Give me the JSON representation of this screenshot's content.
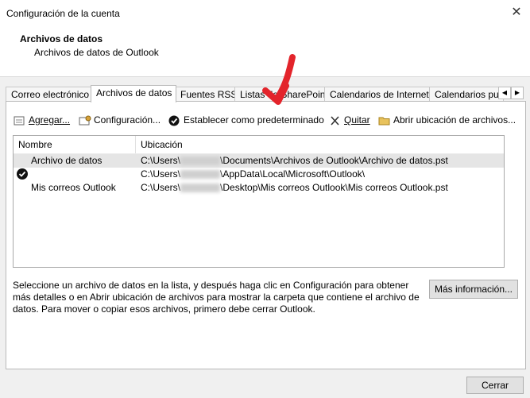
{
  "window": {
    "title": "Configuración de la cuenta",
    "close_glyph": "✕"
  },
  "header": {
    "title": "Archivos de datos",
    "subtitle": "Archivos de datos de Outlook"
  },
  "tabs": [
    {
      "label": "Correo electrónico"
    },
    {
      "label": "Archivos de datos",
      "active": true
    },
    {
      "label": "Fuentes RSS"
    },
    {
      "label": "Listas de SharePoint"
    },
    {
      "label": "Calendarios de Internet"
    },
    {
      "label": "Calendarios pul"
    }
  ],
  "toolbar": {
    "add": "Agregar...",
    "config": "Configuración...",
    "set_default": "Establecer como predeterminado",
    "remove": "Quitar",
    "open_location": "Abrir ubicación de archivos..."
  },
  "list": {
    "col_name": "Nombre",
    "col_location": "Ubicación",
    "rows": [
      {
        "name": "Archivo de datos",
        "loc_prefix": "C:\\Users\\",
        "loc_suffix": "\\Documents\\Archivos de Outlook\\Archivo de datos.pst",
        "default": false,
        "selected": true
      },
      {
        "name": "",
        "loc_prefix": "C:\\Users\\",
        "loc_suffix": "\\AppData\\Local\\Microsoft\\Outlook\\",
        "default": true,
        "selected": false
      },
      {
        "name": "Mis correos Outlook",
        "loc_prefix": "C:\\Users\\",
        "loc_suffix": "\\Desktop\\Mis correos Outlook\\Mis correos Outlook.pst",
        "default": false,
        "selected": false
      }
    ]
  },
  "description": "Seleccione un archivo de datos en la lista, y después haga clic en Configuración para obtener más detalles o en Abrir ubicación de archivos para mostrar la carpeta que contiene el archivo de datos. Para mover o copiar esos archivos, primero debe cerrar Outlook.",
  "buttons": {
    "more_info": "Más información...",
    "close": "Cerrar"
  },
  "colors": {
    "annotation_arrow": "#e3242b",
    "selected_row": "#e5e5e5"
  }
}
